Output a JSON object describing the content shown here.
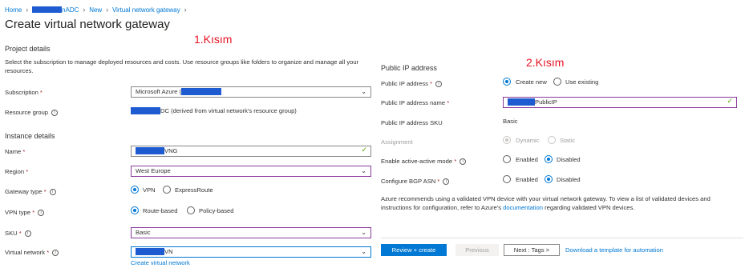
{
  "breadcrumb": {
    "home": "Home",
    "resource_suffix": "nADC",
    "new": "New",
    "current": "Virtual network gateway"
  },
  "page_title": "Create virtual network gateway",
  "annotations": {
    "part1": "1.Kısım",
    "part2": "2.Kısım"
  },
  "project_details": {
    "heading": "Project details",
    "description": "Select the subscription to manage deployed resources and costs. Use resource groups like folders to organize and manage all your resources.",
    "subscription": {
      "label": "Subscription",
      "value": "Microsoft Azure ("
    },
    "resource_group": {
      "label": "Resource group",
      "value": "DC (derived from virtual network's resource group)"
    }
  },
  "instance_details": {
    "heading": "Instance details",
    "name": {
      "label": "Name",
      "value": "VNG"
    },
    "region": {
      "label": "Region",
      "value": "West Europe"
    },
    "gateway_type": {
      "label": "Gateway type",
      "options": [
        "VPN",
        "ExpressRoute"
      ],
      "selected": "VPN"
    },
    "vpn_type": {
      "label": "VPN type",
      "options": [
        "Route-based",
        "Policy-based"
      ],
      "selected": "Route-based"
    },
    "sku": {
      "label": "SKU",
      "value": "Basic"
    },
    "virtual_network": {
      "label": "Virtual network",
      "value": "VN",
      "create_link": "Create virtual network"
    }
  },
  "public_ip": {
    "heading": "Public IP address",
    "address": {
      "label": "Public IP address",
      "options": [
        "Create new",
        "Use existing"
      ],
      "selected": "Create new"
    },
    "name": {
      "label": "Public IP address name",
      "value": "PublicIP"
    },
    "sku": {
      "label": "Public IP address SKU",
      "value": "Basic"
    },
    "assignment": {
      "label": "Assignment",
      "options": [
        "Dynamic",
        "Static"
      ],
      "selected": "Dynamic"
    },
    "active_active": {
      "label": "Enable active-active mode",
      "options": [
        "Enabled",
        "Disabled"
      ],
      "selected": "Disabled"
    },
    "bgp": {
      "label": "Configure BGP ASN",
      "options": [
        "Enabled",
        "Disabled"
      ],
      "selected": "Disabled"
    },
    "note_before_link": "Azure recommends using a validated VPN device with your virtual network gateway. To view a list of validated devices and instructions for configuration, refer to Azure's",
    "note_link": "documentation",
    "note_after_link": "regarding validated VPN devices."
  },
  "footer": {
    "review_create": "Review + create",
    "previous": "Previous",
    "next": "Next : Tags >",
    "download_link": "Download a template for automation"
  },
  "colors": {
    "accent": "#0078d4",
    "annotation": "#e81123",
    "redaction": "#1f5bd0",
    "valid": "#57a300"
  }
}
